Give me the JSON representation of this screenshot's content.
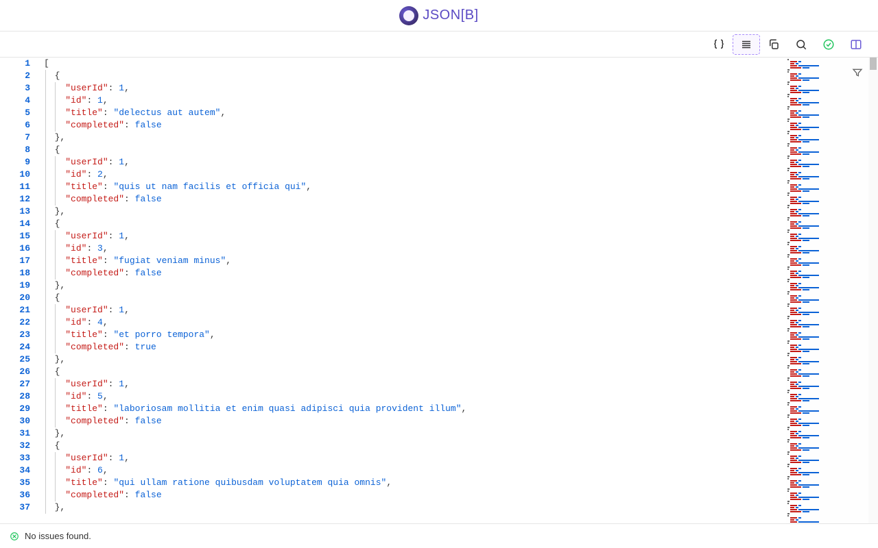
{
  "app": {
    "name": "JSON[B]",
    "name_prefix": "JSON",
    "name_bracket": "[B]"
  },
  "toolbar": {
    "format_raw": "braces-icon",
    "format_beautify": "lines-icon",
    "copy": "copy-icon",
    "search": "search-icon",
    "validate": "check-icon",
    "split": "split-icon"
  },
  "code": {
    "lines": [
      {
        "n": 1,
        "indent": 0,
        "tokens": [
          [
            "pun",
            "["
          ]
        ]
      },
      {
        "n": 2,
        "indent": 1,
        "tokens": [
          [
            "pun",
            "{"
          ]
        ]
      },
      {
        "n": 3,
        "indent": 2,
        "tokens": [
          [
            "key",
            "\"userId\""
          ],
          [
            "pun",
            ": "
          ],
          [
            "num",
            "1"
          ],
          [
            "pun",
            ","
          ]
        ]
      },
      {
        "n": 4,
        "indent": 2,
        "tokens": [
          [
            "key",
            "\"id\""
          ],
          [
            "pun",
            ": "
          ],
          [
            "num",
            "1"
          ],
          [
            "pun",
            ","
          ]
        ]
      },
      {
        "n": 5,
        "indent": 2,
        "tokens": [
          [
            "key",
            "\"title\""
          ],
          [
            "pun",
            ": "
          ],
          [
            "str",
            "\"delectus aut autem\""
          ],
          [
            "pun",
            ","
          ]
        ]
      },
      {
        "n": 6,
        "indent": 2,
        "tokens": [
          [
            "key",
            "\"completed\""
          ],
          [
            "pun",
            ": "
          ],
          [
            "bool",
            "false"
          ]
        ]
      },
      {
        "n": 7,
        "indent": 1,
        "tokens": [
          [
            "pun",
            "},"
          ]
        ]
      },
      {
        "n": 8,
        "indent": 1,
        "tokens": [
          [
            "pun",
            "{"
          ]
        ]
      },
      {
        "n": 9,
        "indent": 2,
        "tokens": [
          [
            "key",
            "\"userId\""
          ],
          [
            "pun",
            ": "
          ],
          [
            "num",
            "1"
          ],
          [
            "pun",
            ","
          ]
        ]
      },
      {
        "n": 10,
        "indent": 2,
        "tokens": [
          [
            "key",
            "\"id\""
          ],
          [
            "pun",
            ": "
          ],
          [
            "num",
            "2"
          ],
          [
            "pun",
            ","
          ]
        ]
      },
      {
        "n": 11,
        "indent": 2,
        "tokens": [
          [
            "key",
            "\"title\""
          ],
          [
            "pun",
            ": "
          ],
          [
            "str",
            "\"quis ut nam facilis et officia qui\""
          ],
          [
            "pun",
            ","
          ]
        ]
      },
      {
        "n": 12,
        "indent": 2,
        "tokens": [
          [
            "key",
            "\"completed\""
          ],
          [
            "pun",
            ": "
          ],
          [
            "bool",
            "false"
          ]
        ]
      },
      {
        "n": 13,
        "indent": 1,
        "tokens": [
          [
            "pun",
            "},"
          ]
        ]
      },
      {
        "n": 14,
        "indent": 1,
        "tokens": [
          [
            "pun",
            "{"
          ]
        ]
      },
      {
        "n": 15,
        "indent": 2,
        "tokens": [
          [
            "key",
            "\"userId\""
          ],
          [
            "pun",
            ": "
          ],
          [
            "num",
            "1"
          ],
          [
            "pun",
            ","
          ]
        ]
      },
      {
        "n": 16,
        "indent": 2,
        "tokens": [
          [
            "key",
            "\"id\""
          ],
          [
            "pun",
            ": "
          ],
          [
            "num",
            "3"
          ],
          [
            "pun",
            ","
          ]
        ]
      },
      {
        "n": 17,
        "indent": 2,
        "tokens": [
          [
            "key",
            "\"title\""
          ],
          [
            "pun",
            ": "
          ],
          [
            "str",
            "\"fugiat veniam minus\""
          ],
          [
            "pun",
            ","
          ]
        ]
      },
      {
        "n": 18,
        "indent": 2,
        "tokens": [
          [
            "key",
            "\"completed\""
          ],
          [
            "pun",
            ": "
          ],
          [
            "bool",
            "false"
          ]
        ]
      },
      {
        "n": 19,
        "indent": 1,
        "tokens": [
          [
            "pun",
            "},"
          ]
        ]
      },
      {
        "n": 20,
        "indent": 1,
        "tokens": [
          [
            "pun",
            "{"
          ]
        ]
      },
      {
        "n": 21,
        "indent": 2,
        "tokens": [
          [
            "key",
            "\"userId\""
          ],
          [
            "pun",
            ": "
          ],
          [
            "num",
            "1"
          ],
          [
            "pun",
            ","
          ]
        ]
      },
      {
        "n": 22,
        "indent": 2,
        "tokens": [
          [
            "key",
            "\"id\""
          ],
          [
            "pun",
            ": "
          ],
          [
            "num",
            "4"
          ],
          [
            "pun",
            ","
          ]
        ]
      },
      {
        "n": 23,
        "indent": 2,
        "tokens": [
          [
            "key",
            "\"title\""
          ],
          [
            "pun",
            ": "
          ],
          [
            "str",
            "\"et porro tempora\""
          ],
          [
            "pun",
            ","
          ]
        ]
      },
      {
        "n": 24,
        "indent": 2,
        "tokens": [
          [
            "key",
            "\"completed\""
          ],
          [
            "pun",
            ": "
          ],
          [
            "bool",
            "true"
          ]
        ]
      },
      {
        "n": 25,
        "indent": 1,
        "tokens": [
          [
            "pun",
            "},"
          ]
        ]
      },
      {
        "n": 26,
        "indent": 1,
        "tokens": [
          [
            "pun",
            "{"
          ]
        ]
      },
      {
        "n": 27,
        "indent": 2,
        "tokens": [
          [
            "key",
            "\"userId\""
          ],
          [
            "pun",
            ": "
          ],
          [
            "num",
            "1"
          ],
          [
            "pun",
            ","
          ]
        ]
      },
      {
        "n": 28,
        "indent": 2,
        "tokens": [
          [
            "key",
            "\"id\""
          ],
          [
            "pun",
            ": "
          ],
          [
            "num",
            "5"
          ],
          [
            "pun",
            ","
          ]
        ]
      },
      {
        "n": 29,
        "indent": 2,
        "tokens": [
          [
            "key",
            "\"title\""
          ],
          [
            "pun",
            ": "
          ],
          [
            "str",
            "\"laboriosam mollitia et enim quasi adipisci quia provident illum\""
          ],
          [
            "pun",
            ","
          ]
        ]
      },
      {
        "n": 30,
        "indent": 2,
        "tokens": [
          [
            "key",
            "\"completed\""
          ],
          [
            "pun",
            ": "
          ],
          [
            "bool",
            "false"
          ]
        ]
      },
      {
        "n": 31,
        "indent": 1,
        "tokens": [
          [
            "pun",
            "},"
          ]
        ]
      },
      {
        "n": 32,
        "indent": 1,
        "tokens": [
          [
            "pun",
            "{"
          ]
        ]
      },
      {
        "n": 33,
        "indent": 2,
        "tokens": [
          [
            "key",
            "\"userId\""
          ],
          [
            "pun",
            ": "
          ],
          [
            "num",
            "1"
          ],
          [
            "pun",
            ","
          ]
        ]
      },
      {
        "n": 34,
        "indent": 2,
        "tokens": [
          [
            "key",
            "\"id\""
          ],
          [
            "pun",
            ": "
          ],
          [
            "num",
            "6"
          ],
          [
            "pun",
            ","
          ]
        ]
      },
      {
        "n": 35,
        "indent": 2,
        "tokens": [
          [
            "key",
            "\"title\""
          ],
          [
            "pun",
            ": "
          ],
          [
            "str",
            "\"qui ullam ratione quibusdam voluptatem quia omnis\""
          ],
          [
            "pun",
            ","
          ]
        ]
      },
      {
        "n": 36,
        "indent": 2,
        "tokens": [
          [
            "key",
            "\"completed\""
          ],
          [
            "pun",
            ": "
          ],
          [
            "bool",
            "false"
          ]
        ]
      },
      {
        "n": 37,
        "indent": 1,
        "tokens": [
          [
            "pun",
            "},"
          ]
        ]
      }
    ]
  },
  "status": {
    "message": "No issues found."
  }
}
